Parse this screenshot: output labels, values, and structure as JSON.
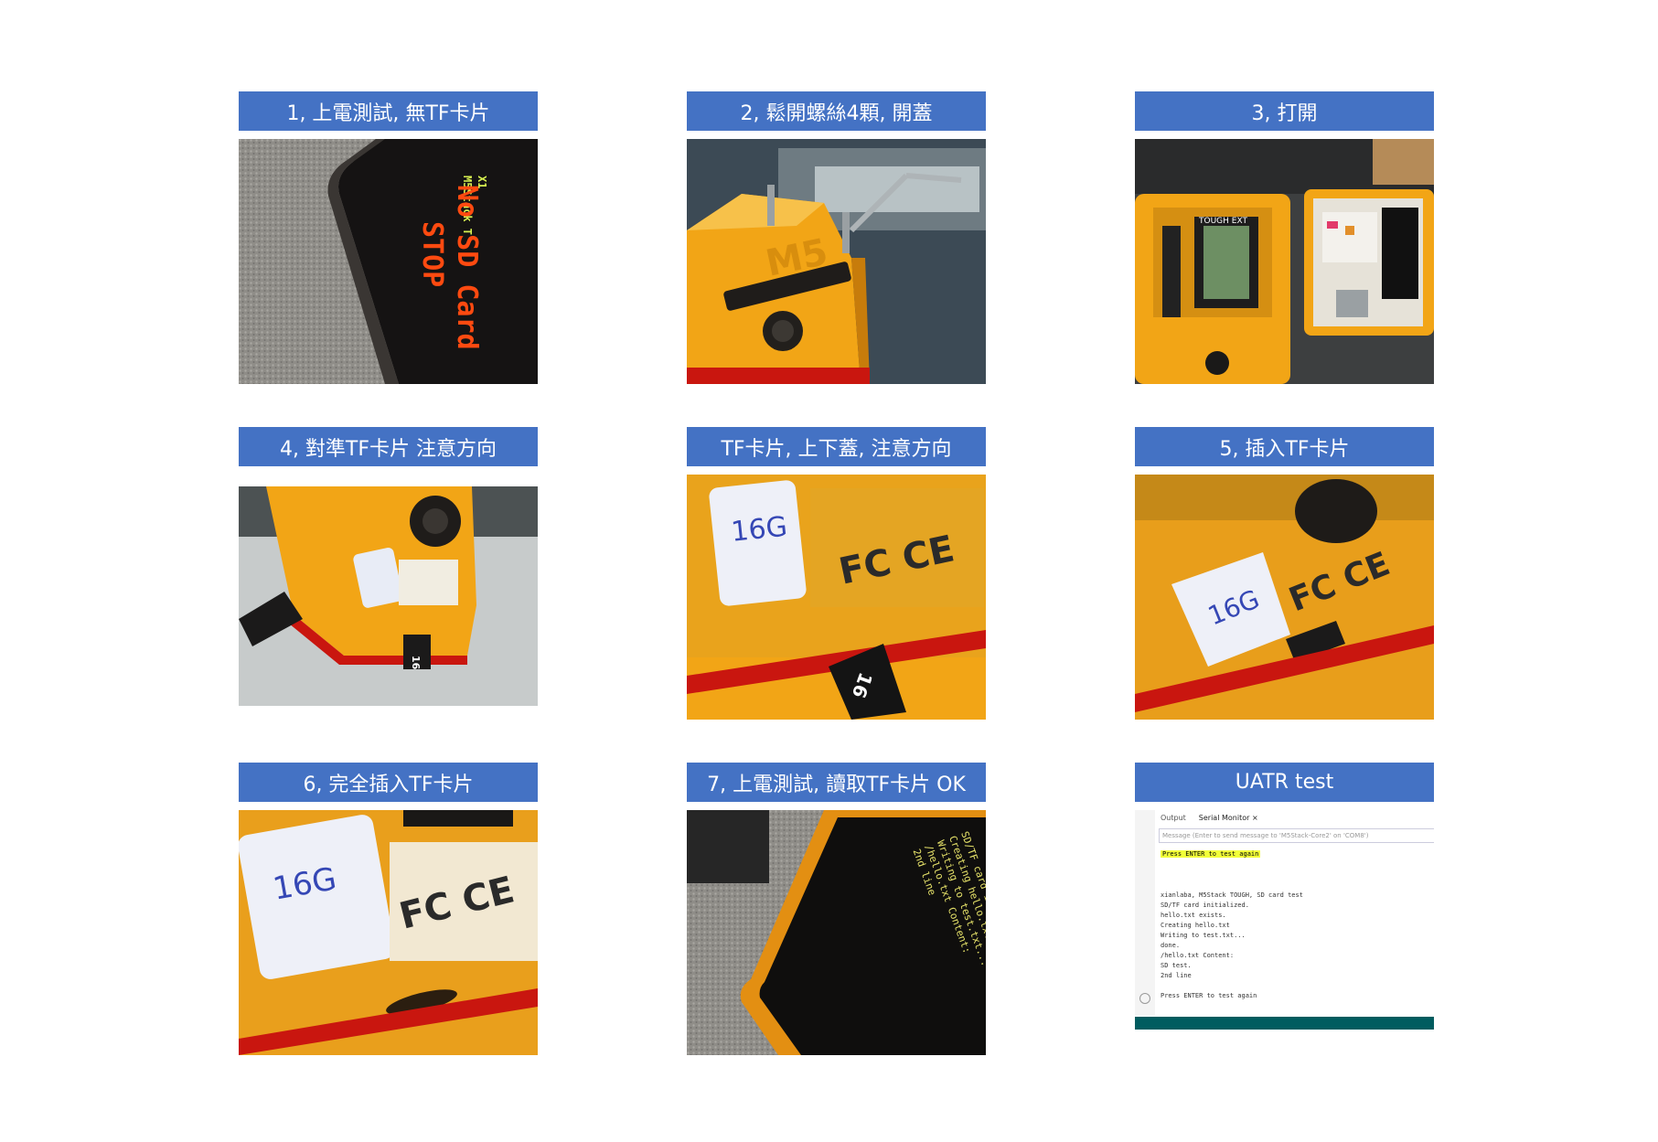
{
  "steps": [
    {
      "title": "1, 上電測試, 無TF卡片",
      "screen_text": [
        "X1",
        "M5Stack T",
        "No SD Card",
        "STOP"
      ]
    },
    {
      "title": "2, 鬆開螺絲4顆, 開蓋",
      "logo_text": "M5"
    },
    {
      "title": "3, 打開",
      "label_text": "TOUGH EXT"
    },
    {
      "title": "4, 對準TF卡片 注意方向"
    },
    {
      "title": "TF卡片, 上下蓋, 注意方向",
      "card_text": "16"
    },
    {
      "title": "5, 插入TF卡片"
    },
    {
      "title": "6, 完全插入TF卡片"
    },
    {
      "title": "7, 上電測試, 讀取TF卡片 OK"
    },
    {
      "title": "UATR test"
    }
  ],
  "serial_monitor": {
    "tabs": [
      "Output",
      "Serial Monitor"
    ],
    "close_glyph": "×",
    "input_placeholder": "Message (Enter to send message to 'M5Stack-Core2' on 'COM8')",
    "highlighted_line": "Press ENTER to test again",
    "lines": [
      "xianlaba, M5Stack TOUGH, SD card test",
      "SD/TF card initialized.",
      "hello.txt exists.",
      "Creating hello.txt",
      "Writing to test.txt...",
      "done.",
      "/hello.txt Content:",
      "SD test.",
      "2nd line",
      "",
      "Press ENTER to test again"
    ]
  },
  "colors": {
    "header_bg": "#4472c4",
    "header_text": "#ffffff",
    "device_orange": "#f2a516",
    "screen_black": "#0e0d0d",
    "screen_orange_text": "#ff4a10",
    "screen_green_text": "#d6f050",
    "highlight_yellow": "#f2ff39"
  }
}
